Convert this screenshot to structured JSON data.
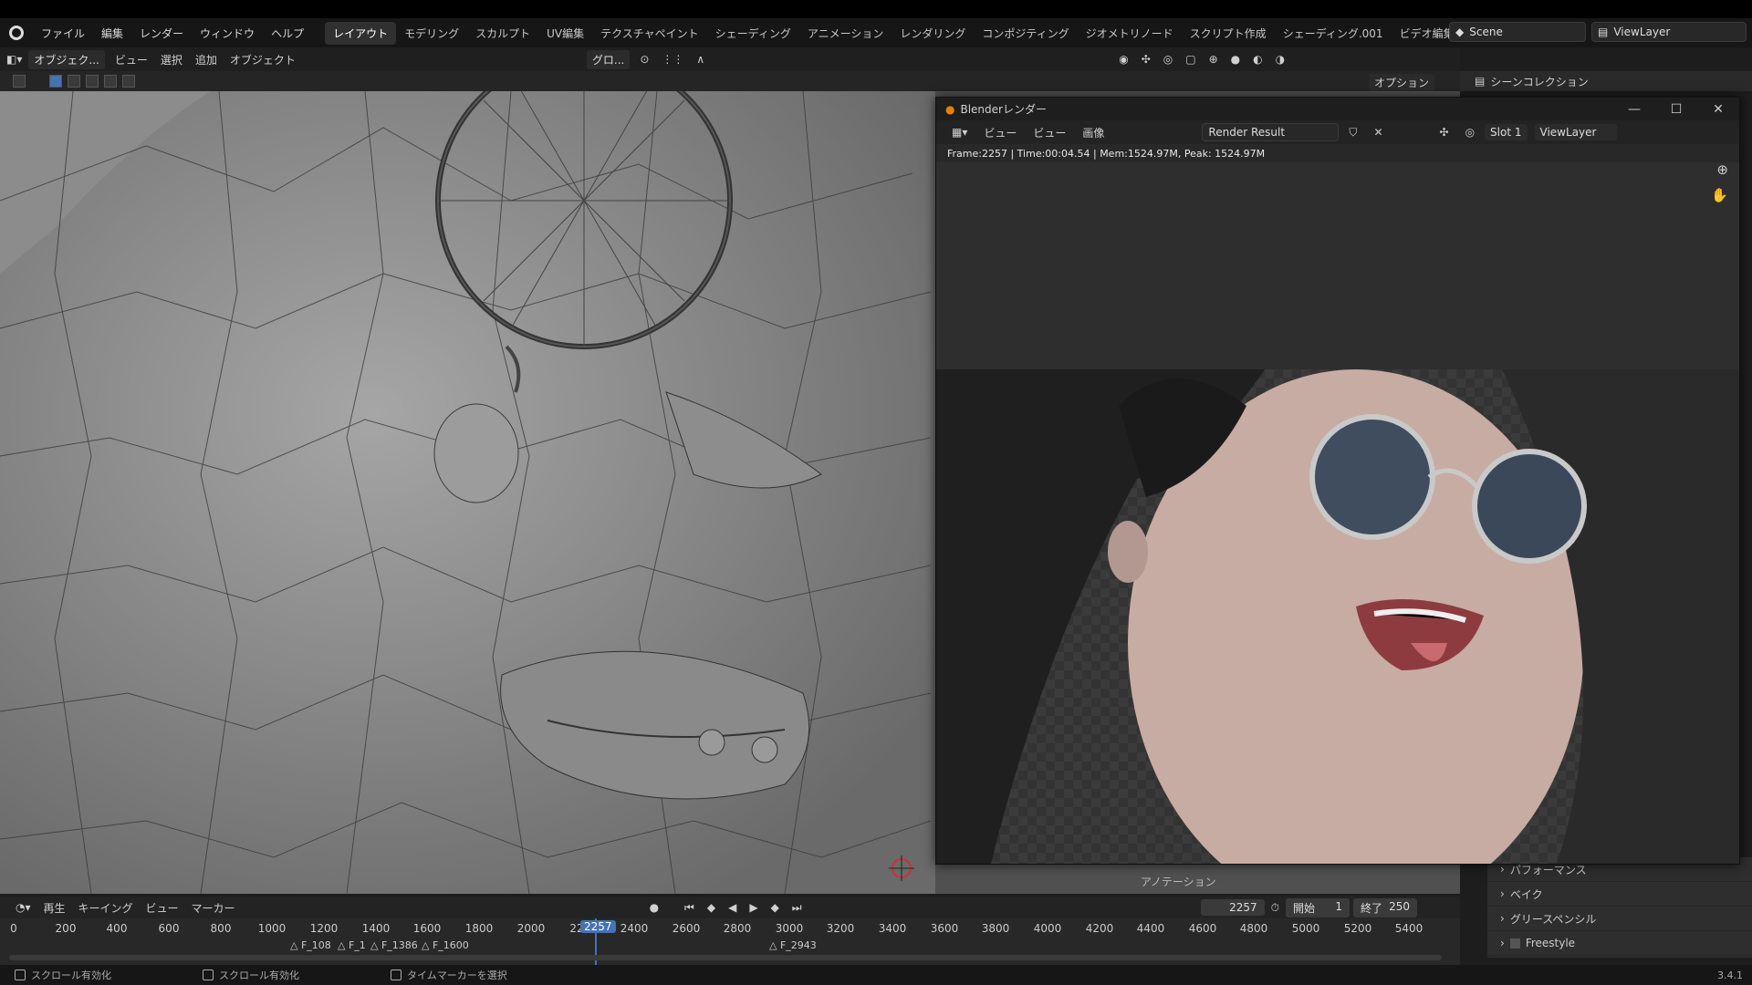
{
  "menubar": {
    "menus": [
      "ファイル",
      "編集",
      "レンダー",
      "ウィンドウ",
      "ヘルプ"
    ],
    "workspaces": [
      "レイアウト",
      "モデリング",
      "スカルプト",
      "UV編集",
      "テクスチャペイント",
      "シェーディング",
      "アニメーション",
      "レンダリング",
      "コンポジティング",
      "ジオメトリノード",
      "スクリプト作成",
      "シェーディング.001",
      "ビデオ編集"
    ],
    "scene": "Scene",
    "view_layer": "ViewLayer"
  },
  "viewport_header": {
    "mode": "オブジェク...",
    "items": [
      "ビュー",
      "選択",
      "追加",
      "オブジェクト"
    ],
    "transform": "グロ...",
    "options": "オプション"
  },
  "outliner": {
    "title": "シーンコレクション"
  },
  "render_window": {
    "title": "Blenderレンダー",
    "menus": [
      "ビュー",
      "ビュー",
      "画像"
    ],
    "image_name": "Render Result",
    "slot": "Slot 1",
    "view_layer": "ViewLayer",
    "info": "Frame:2257 | Time:00:04.54 | Mem:1524.97M, Peak: 1524.97M"
  },
  "annotation_label": "アノテーション",
  "properties": {
    "rows": [
      "パフォーマンス",
      "ベイク",
      "グリースペンシル",
      "Freestyle"
    ]
  },
  "timeline": {
    "menus": [
      "再生",
      "キーイング",
      "ビュー",
      "マーカー"
    ],
    "current_frame": "2257",
    "start_label": "開始",
    "start": "1",
    "end_label": "終了",
    "end": "250",
    "ticks": [
      "0",
      "200",
      "400",
      "600",
      "800",
      "1000",
      "1200",
      "1400",
      "1600",
      "1800",
      "2000",
      "22",
      "2400",
      "2600",
      "2800",
      "3000",
      "3200",
      "3400",
      "3600",
      "3800",
      "4000",
      "4200",
      "4400",
      "4600",
      "4800",
      "5000",
      "5200",
      "5400"
    ],
    "playhead": "2257",
    "markers": [
      "F_108",
      "F_1",
      "F_1386",
      "F_1600",
      "F_2943"
    ]
  },
  "statusbar": {
    "items": [
      "スクロール有効化",
      "スクロール有効化",
      "タイムマーカーを選択"
    ],
    "version": "3.4.1"
  }
}
